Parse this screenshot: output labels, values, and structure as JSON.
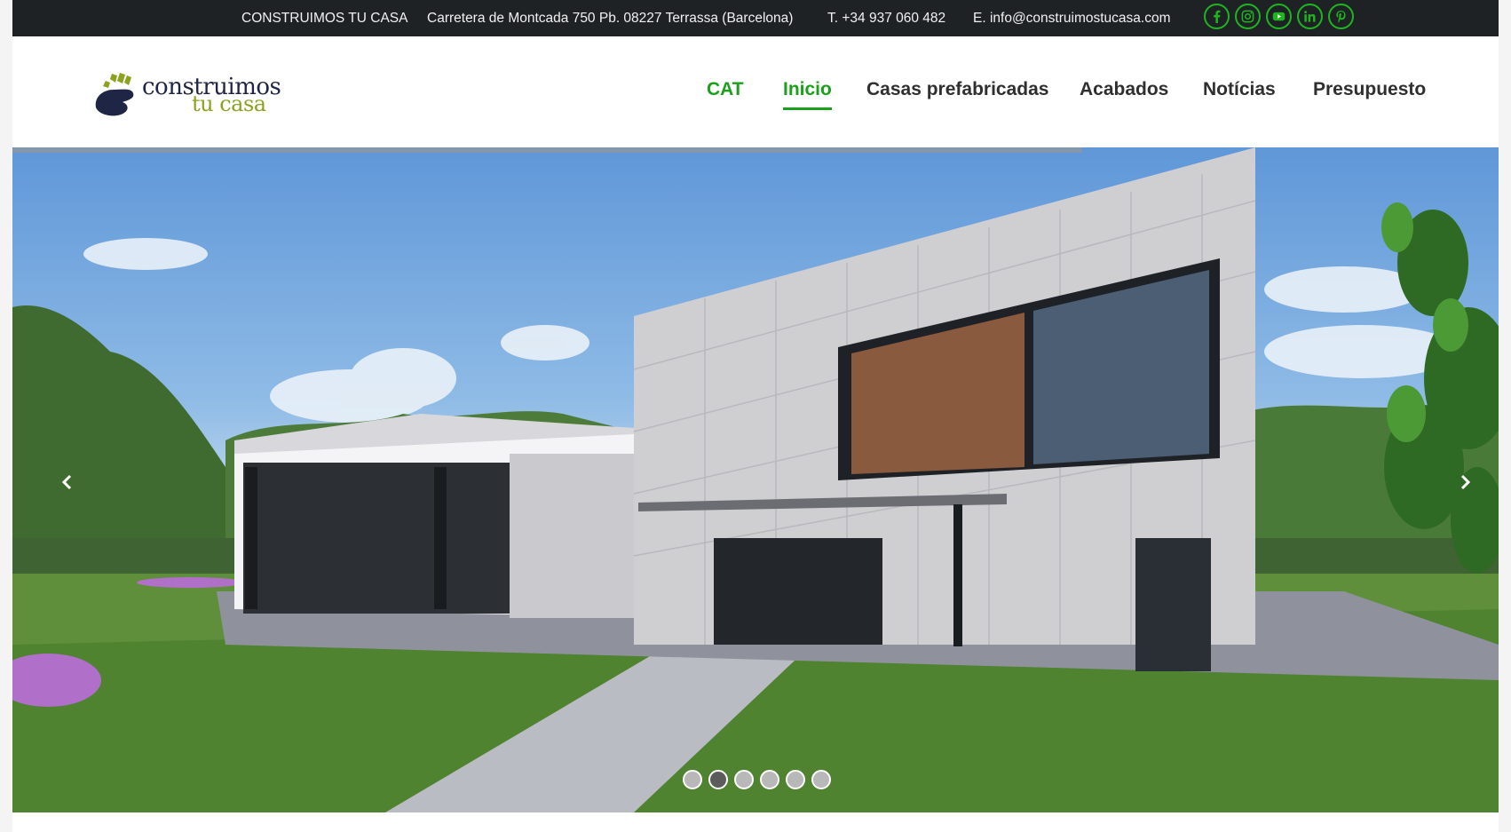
{
  "topbar": {
    "company": "CONSTRUIMOS TU CASA",
    "address": "Carretera de Montcada 750 Pb. 08227 Terrassa (Barcelona)",
    "phone": "T. +34 937 060 482",
    "email": "E. info@construimostucasa.com",
    "social": [
      "facebook-icon",
      "instagram-icon",
      "youtube-icon",
      "linkedin-icon",
      "pinterest-icon"
    ]
  },
  "header": {
    "logo": {
      "line1": "construimos",
      "line2": "tu casa"
    },
    "nav": [
      {
        "label": "CAT",
        "active": false,
        "highlight": true
      },
      {
        "label": "Inicio",
        "active": true,
        "highlight": true
      },
      {
        "label": "Casas prefabricadas",
        "active": false,
        "highlight": false
      },
      {
        "label": "Acabados",
        "active": false,
        "highlight": false
      },
      {
        "label": "Notícias",
        "active": false,
        "highlight": false
      },
      {
        "label": "Presupuesto",
        "active": false,
        "highlight": false
      }
    ]
  },
  "slider": {
    "slide_count": 6,
    "active_index": 1,
    "progress": 0.72,
    "prev_icon": "chevron-left-icon",
    "next_icon": "chevron-right-icon"
  },
  "colors": {
    "accent": "#1aa01a",
    "topbar_bg": "#1f2225",
    "nav_text": "#2f2f2f"
  }
}
